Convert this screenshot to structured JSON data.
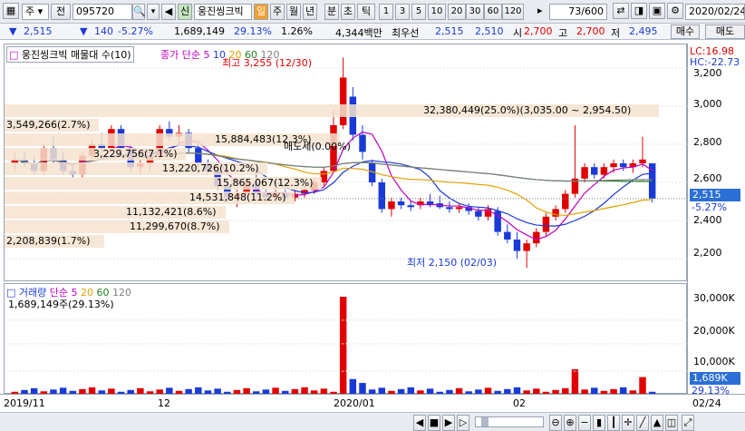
{
  "toolbar": {
    "market_select": "주",
    "type_btn": "전",
    "code": "095720",
    "stock_name": "웅진씽크빅",
    "periods": [
      "일",
      "주",
      "월",
      "년",
      "분",
      "초",
      "틱"
    ],
    "active_period": "일",
    "numbers": [
      "1",
      "3",
      "5",
      "10",
      "20",
      "30",
      "60",
      "120"
    ],
    "count": "73",
    "count_total": "/600",
    "date": "2020/02/24"
  },
  "quote": {
    "price": "2,515",
    "change": "140",
    "change_pct": "-5.27%",
    "volume": "1,689,149",
    "vol_ratio": "29.13%",
    "turnover_ratio": "1.26%",
    "amount": "4,344백만",
    "best_ask_label": "최우선",
    "best_ask": "2,515",
    "best_bid": "2,510",
    "open_label": "시",
    "open": "2,700",
    "high_label": "고",
    "high": "2,700",
    "low_label": "저",
    "low": "2,495",
    "buy_btn": "매수",
    "sell_btn": "매도"
  },
  "price_chart": {
    "legend_main": "웅진씽크빅 매물대 수(10)",
    "legend_ma": "종가 단순",
    "ma_periods": [
      "5",
      "10",
      "20",
      "60",
      "120"
    ],
    "ma_colors": [
      "#c000c0",
      "#1a3ad8",
      "#e0a000",
      "#208020",
      "#808080"
    ],
    "lc": "LC:16.98",
    "hc": "HC:-22.73",
    "high_note": "최고 3,255 (12/30)",
    "low_note": "최저 2,150 (02/03)",
    "sell_note": "매도세(0.00%)",
    "bands": [
      {
        "label": "32,380,449(25.0%)(3,035.00 ~ 2,954.50)"
      },
      {
        "label": "3,549,266(2.7%)"
      },
      {
        "label": "15,884,483(12.3%)"
      },
      {
        "label": "3,229,756(7.1%)"
      },
      {
        "label": "13,220,726(10.2%)"
      },
      {
        "label": "15,865,067(12.3%)"
      },
      {
        "label": "14,531,848(11.2%)"
      },
      {
        "label": "11,132,421(8.6%)"
      },
      {
        "label": "11,299,670(8.7%)"
      },
      {
        "label": "2,208,839(1.7%)"
      }
    ],
    "current_price_tag": "2,515",
    "current_pct_tag": "-5.27%"
  },
  "chart_data": {
    "type": "candlestick",
    "y_ticks": [
      "3,200",
      "3,000",
      "2,800",
      "2,600",
      "2,400",
      "2,200"
    ],
    "ylim": [
      2100,
      3300
    ],
    "x_labels": [
      "2019/11",
      "12",
      "2020/01",
      "02",
      "02/24"
    ],
    "candles": [
      [
        2700,
        2760,
        2660,
        2720
      ],
      [
        2720,
        2760,
        2680,
        2700
      ],
      [
        2700,
        2740,
        2640,
        2660
      ],
      [
        2660,
        2800,
        2640,
        2780
      ],
      [
        2780,
        2840,
        2700,
        2720
      ],
      [
        2720,
        2760,
        2640,
        2660
      ],
      [
        2660,
        2700,
        2620,
        2640
      ],
      [
        2640,
        2760,
        2620,
        2740
      ],
      [
        2740,
        2820,
        2720,
        2800
      ],
      [
        2800,
        2860,
        2760,
        2780
      ],
      [
        2780,
        2900,
        2760,
        2880
      ],
      [
        2880,
        2900,
        2760,
        2780
      ],
      [
        2780,
        2800,
        2660,
        2680
      ],
      [
        2680,
        2720,
        2640,
        2700
      ],
      [
        2700,
        2760,
        2660,
        2740
      ],
      [
        2740,
        2900,
        2720,
        2880
      ],
      [
        2880,
        2920,
        2820,
        2840
      ],
      [
        2840,
        2900,
        2800,
        2860
      ],
      [
        2860,
        2880,
        2760,
        2780
      ],
      [
        2780,
        2800,
        2680,
        2700
      ],
      [
        2700,
        2720,
        2640,
        2660
      ],
      [
        2660,
        2680,
        2560,
        2580
      ],
      [
        2580,
        2600,
        2500,
        2520
      ],
      [
        2520,
        2560,
        2470,
        2540
      ],
      [
        2540,
        2620,
        2520,
        2600
      ],
      [
        2600,
        2640,
        2520,
        2540
      ],
      [
        2540,
        2560,
        2500,
        2520
      ],
      [
        2520,
        2560,
        2500,
        2540
      ],
      [
        2540,
        2560,
        2500,
        2520
      ],
      [
        2520,
        2560,
        2500,
        2540
      ],
      [
        2540,
        2580,
        2520,
        2560
      ],
      [
        2560,
        2620,
        2540,
        2600
      ],
      [
        2600,
        2680,
        2580,
        2660
      ],
      [
        2660,
        2980,
        2650,
        2900
      ],
      [
        2900,
        3255,
        2880,
        3150
      ],
      [
        3050,
        3100,
        2820,
        2850
      ],
      [
        2850,
        2900,
        2720,
        2760
      ],
      [
        2700,
        2720,
        2580,
        2600
      ],
      [
        2600,
        2620,
        2440,
        2460
      ],
      [
        2460,
        2520,
        2420,
        2500
      ],
      [
        2500,
        2520,
        2460,
        2480
      ],
      [
        2480,
        2500,
        2450,
        2470
      ],
      [
        2480,
        2520,
        2460,
        2500
      ],
      [
        2500,
        2540,
        2470,
        2480
      ],
      [
        2490,
        2530,
        2460,
        2470
      ],
      [
        2470,
        2500,
        2440,
        2460
      ],
      [
        2460,
        2490,
        2440,
        2470
      ],
      [
        2470,
        2490,
        2430,
        2450
      ],
      [
        2450,
        2470,
        2400,
        2420
      ],
      [
        2420,
        2480,
        2400,
        2460
      ],
      [
        2450,
        2470,
        2320,
        2340
      ],
      [
        2340,
        2380,
        2280,
        2300
      ],
      [
        2300,
        2340,
        2200,
        2240
      ],
      [
        2240,
        2300,
        2150,
        2280
      ],
      [
        2280,
        2360,
        2260,
        2340
      ],
      [
        2340,
        2440,
        2320,
        2420
      ],
      [
        2420,
        2480,
        2400,
        2460
      ],
      [
        2460,
        2560,
        2440,
        2540
      ],
      [
        2540,
        2900,
        2520,
        2620
      ],
      [
        2620,
        2700,
        2600,
        2680
      ],
      [
        2680,
        2700,
        2620,
        2640
      ],
      [
        2640,
        2700,
        2620,
        2680
      ],
      [
        2680,
        2720,
        2650,
        2700
      ],
      [
        2700,
        2720,
        2660,
        2680
      ],
      [
        2680,
        2720,
        2650,
        2700
      ],
      [
        2700,
        2840,
        2680,
        2720
      ],
      [
        2700,
        2700,
        2495,
        2515
      ]
    ]
  },
  "volume_chart": {
    "legend": "거래량",
    "legend_ma": "단순",
    "ma_periods": [
      "5",
      "20",
      "60",
      "120"
    ],
    "value_label": "1,689,149주(29.13%)",
    "y_ticks": [
      "30,000K",
      "20,000K",
      "10,000K"
    ],
    "current_tag": "1,689K",
    "current_pct": "29.13%"
  },
  "bottom": {
    "x_labels": [
      "2019/11",
      "12",
      "2020/01",
      "02",
      "02/24"
    ]
  }
}
